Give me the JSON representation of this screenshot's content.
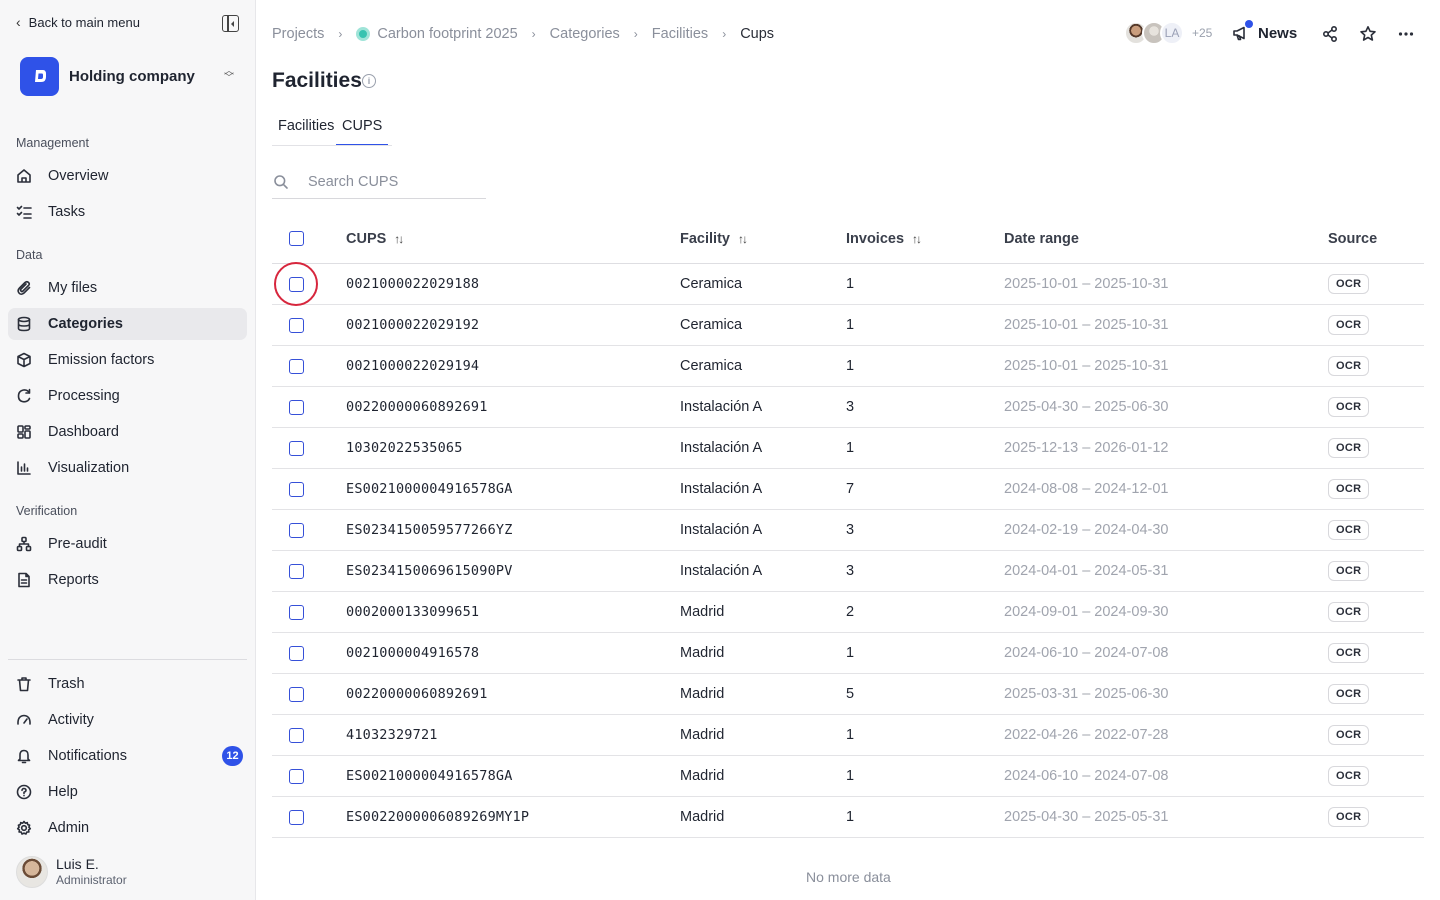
{
  "sidebar": {
    "back_label": "Back to main menu",
    "org_name": "Holding company",
    "sections": {
      "management": "Management",
      "data": "Data",
      "verification": "Verification"
    },
    "items": {
      "overview": "Overview",
      "tasks": "Tasks",
      "my_files": "My files",
      "categories": "Categories",
      "emission_factors": "Emission factors",
      "processing": "Processing",
      "dashboard": "Dashboard",
      "visualization": "Visualization",
      "pre_audit": "Pre-audit",
      "reports": "Reports",
      "trash": "Trash",
      "activity": "Activity",
      "notifications": "Notifications",
      "help": "Help",
      "admin": "Admin"
    },
    "active_item": "categories",
    "notifications_count": "12",
    "user": {
      "name": "Luis E.",
      "role": "Administrator"
    }
  },
  "header": {
    "breadcrumb": [
      "Projects",
      "Carbon footprint 2025",
      "Categories",
      "Facilities",
      "Cups"
    ],
    "collaborator_initials": "LA",
    "collaborators_more": "+25",
    "news_label": "News"
  },
  "page": {
    "title": "Facilities",
    "tabs": [
      "Facilities",
      "CUPS"
    ],
    "active_tab": "CUPS",
    "search_placeholder": "Search CUPS"
  },
  "table": {
    "columns": {
      "cups": "CUPS",
      "facility": "Facility",
      "invoices": "Invoices",
      "date_range": "Date range",
      "source": "Source"
    },
    "rows": [
      {
        "cups": "0021000022029188",
        "facility": "Ceramica",
        "invoices": "1",
        "date_range": "2025-10-01 – 2025-10-31",
        "source": "OCR"
      },
      {
        "cups": "0021000022029192",
        "facility": "Ceramica",
        "invoices": "1",
        "date_range": "2025-10-01 – 2025-10-31",
        "source": "OCR"
      },
      {
        "cups": "0021000022029194",
        "facility": "Ceramica",
        "invoices": "1",
        "date_range": "2025-10-01 – 2025-10-31",
        "source": "OCR"
      },
      {
        "cups": "00220000060892691",
        "facility": "Instalación A",
        "invoices": "3",
        "date_range": "2025-04-30 – 2025-06-30",
        "source": "OCR"
      },
      {
        "cups": "10302022535065",
        "facility": "Instalación A",
        "invoices": "1",
        "date_range": "2025-12-13 – 2026-01-12",
        "source": "OCR"
      },
      {
        "cups": "ES0021000004916578GA",
        "facility": "Instalación A",
        "invoices": "7",
        "date_range": "2024-08-08 – 2024-12-01",
        "source": "OCR"
      },
      {
        "cups": "ES0234150059577266YZ",
        "facility": "Instalación A",
        "invoices": "3",
        "date_range": "2024-02-19 – 2024-04-30",
        "source": "OCR"
      },
      {
        "cups": "ES0234150069615090PV",
        "facility": "Instalación A",
        "invoices": "3",
        "date_range": "2024-04-01 – 2024-05-31",
        "source": "OCR"
      },
      {
        "cups": "0002000133099651",
        "facility": "Madrid",
        "invoices": "2",
        "date_range": "2024-09-01 – 2024-09-30",
        "source": "OCR"
      },
      {
        "cups": "0021000004916578",
        "facility": "Madrid",
        "invoices": "1",
        "date_range": "2024-06-10 – 2024-07-08",
        "source": "OCR"
      },
      {
        "cups": "00220000060892691",
        "facility": "Madrid",
        "invoices": "5",
        "date_range": "2025-03-31 – 2025-06-30",
        "source": "OCR"
      },
      {
        "cups": "41032329721",
        "facility": "Madrid",
        "invoices": "1",
        "date_range": "2022-04-26 – 2022-07-28",
        "source": "OCR"
      },
      {
        "cups": "ES0021000004916578GA",
        "facility": "Madrid",
        "invoices": "1",
        "date_range": "2024-06-10 – 2024-07-08",
        "source": "OCR"
      },
      {
        "cups": "ES0022000006089269MY1P",
        "facility": "Madrid",
        "invoices": "1",
        "date_range": "2025-04-30 – 2025-05-31",
        "source": "OCR"
      }
    ],
    "footer": "No more data"
  },
  "colors": {
    "accent": "#2f52e8",
    "highlight": "#d7263d",
    "project_dot": "#37c3b0"
  },
  "icons": {
    "back": "chevron-left-icon",
    "collapse": "sidebar-collapse-icon",
    "org_switch": "chevrons-up-down-icon",
    "news": "megaphone-icon",
    "share": "share-icon",
    "favorite": "star-icon",
    "more": "more-horizontal-icon",
    "search": "search-icon",
    "sort": "sort-icon"
  }
}
